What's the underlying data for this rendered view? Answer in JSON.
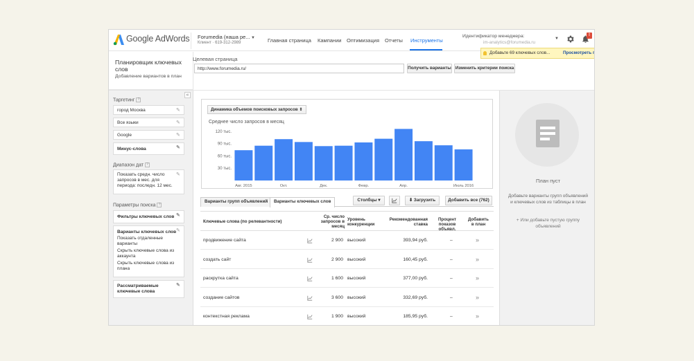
{
  "header": {
    "logo_text": "Google AdWords",
    "account_name": "Forumedia (наша ре...",
    "account_id": "Клиент · 619-312-2989",
    "nav": [
      "Главная страница",
      "Кампании",
      "Оптимизация",
      "Отчеты",
      "Инструменты"
    ],
    "active_nav": "Инструменты",
    "manager_label": "Идентификатор менеджера:",
    "manager_email": "im-analytics@forumedia.ru",
    "notifications_count": "!"
  },
  "notification": {
    "message": "Добавьте 69 ключевых слов...",
    "link": "Просмотреть предл"
  },
  "page": {
    "title": "Планировщик ключевых слов",
    "subtitle": "Добавление вариантов в план",
    "target_label": "Целевая страница",
    "url_value": "http://www.forumedia.ru/",
    "get_ideas": "Получить варианты",
    "modify_search": "Изменить критерии поиска"
  },
  "left": {
    "targeting_header": "Таргетинг",
    "targeting_items": [
      "город Москва",
      "Все языки",
      "Google"
    ],
    "negative_keywords": "Минус-слова",
    "date_header": "Диапазон дат",
    "date_text": "Показать средн. число запросов в мес. для периода: последн. 12 мес.",
    "search_params_header": "Параметры поиска",
    "keyword_filters": "Фильтры ключевых слов",
    "keyword_options_title": "Варианты ключевых слов",
    "keyword_options": [
      "Показать отдаленные варианты",
      "Скрыть ключевые слова из аккаунта",
      "Скрыть ключевые слова из плана"
    ],
    "keywords_to_include": "Рассматриваемые ключевые слова"
  },
  "chart_dropdown": "Динамика объемов поисковых запросов",
  "chart_data": {
    "type": "bar",
    "title": "Среднее число запросов в месяц",
    "categories": [
      "Авг. 2015",
      "Сент.",
      "Окт.",
      "Нояб.",
      "Дек.",
      "Янв.",
      "Февр.",
      "Март",
      "Апр.",
      "Май",
      "Июнь",
      "Июль 2016"
    ],
    "x_tick_labels": [
      "Авг. 2015",
      "Окт.",
      "Дек.",
      "Февр.",
      "Апр.",
      "Июль 2016"
    ],
    "values": [
      74000,
      85000,
      101000,
      94000,
      84000,
      85000,
      93000,
      102000,
      126000,
      96000,
      86000,
      76000
    ],
    "y_tick_labels": [
      "120 тыс.",
      "90 тыс.",
      "60 тыс.",
      "30 тыс."
    ],
    "ylim": [
      0,
      125000
    ],
    "y_ticks": [
      120000,
      90000,
      60000,
      30000
    ],
    "color": "#4285f4"
  },
  "tabs": {
    "ad_groups": "Варианты групп объявлений",
    "keyword_ideas": "Варианты ключевых слов",
    "columns": "Столбцы",
    "download": "Загрузить",
    "add_all": "Добавить все (762)"
  },
  "table": {
    "headers": {
      "keyword": "Ключевые слова (по релевантности)",
      "avg": "Ср. число запросов в месяц",
      "competition": "Уровень конкуренции",
      "bid": "Рекомендованная ставка",
      "impr": "Процент показов объявл.",
      "add": "Добавить в план"
    },
    "rows": [
      {
        "keyword": "продвижение сайта",
        "avg": "2 900",
        "competition": "высокий",
        "bid": "393,94 руб.",
        "impr": "–"
      },
      {
        "keyword": "создать сайт",
        "avg": "2 900",
        "competition": "высокий",
        "bid": "160,45 руб.",
        "impr": "–"
      },
      {
        "keyword": "раскрутка сайта",
        "avg": "1 600",
        "competition": "высокий",
        "bid": "377,00 руб.",
        "impr": "–"
      },
      {
        "keyword": "создание сайтов",
        "avg": "3 600",
        "competition": "высокий",
        "bid": "332,69 руб.",
        "impr": "–"
      },
      {
        "keyword": "контекстная реклама",
        "avg": "1 900",
        "competition": "высокий",
        "bid": "185,95 руб.",
        "impr": "–"
      }
    ]
  },
  "right": {
    "empty_title": "План пуст",
    "empty_text": "Добавьте варианты групп объявлений и ключевых слов из таблицы в план",
    "add_empty_group": "+ Или добавьте пустую группу объявлений"
  }
}
